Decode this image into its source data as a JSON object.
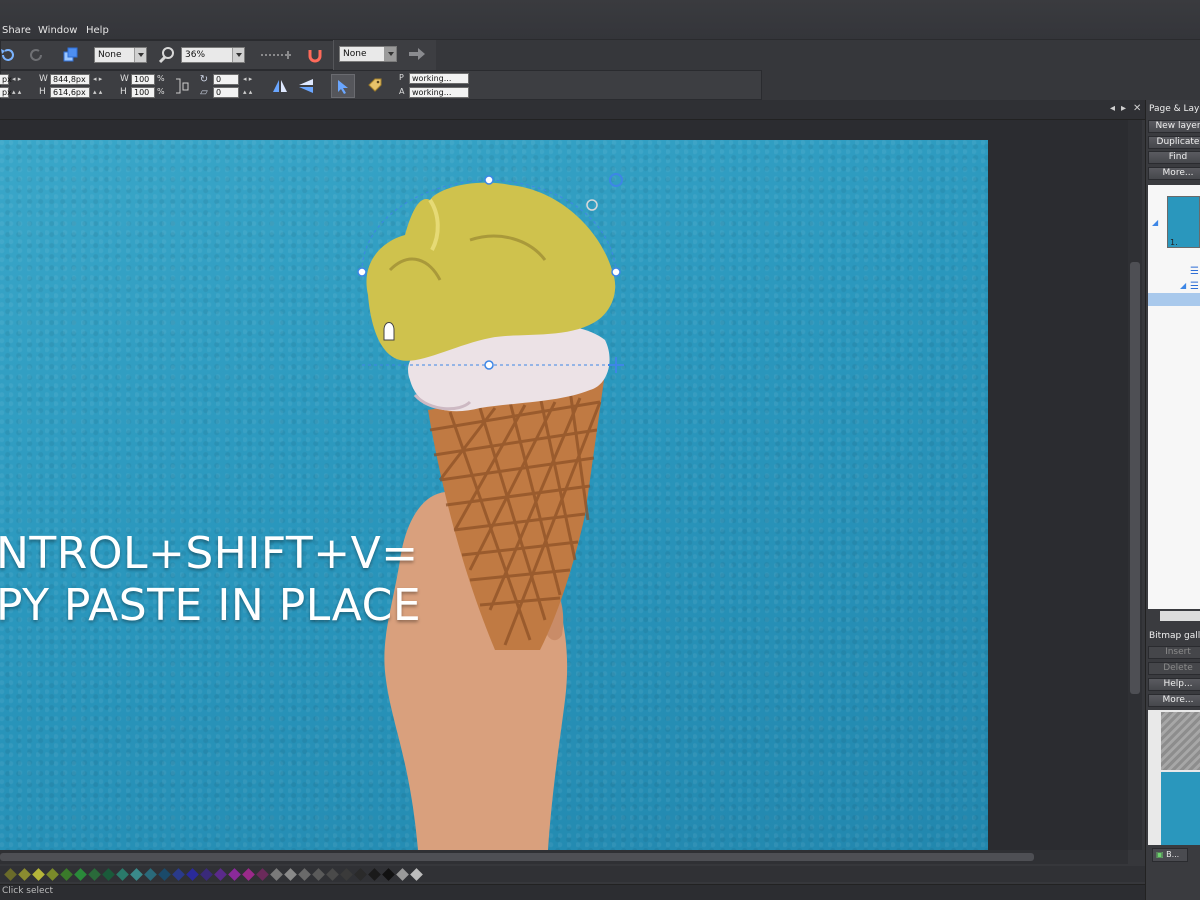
{
  "menu": {
    "items": [
      {
        "label": "Share"
      },
      {
        "label": "Window"
      },
      {
        "label": "Help"
      }
    ]
  },
  "toolbar": {
    "combo_none_1": "None",
    "zoom": "36%",
    "combo_none_2": "None"
  },
  "infobar": {
    "x_unit": "px",
    "y_unit": "px",
    "w_label": "W",
    "w_value": "844,8px",
    "h_label": "H",
    "h_value": "614,6px",
    "w_pct_label": "W",
    "w_pct": "100",
    "h_pct_label": "H",
    "h_pct": "100",
    "pct_sign": "%",
    "rotate_value": "0",
    "skew_value": "0",
    "p_label": "P",
    "p_value": "working...",
    "a_label": "A",
    "a_value": "working..."
  },
  "canvas": {
    "overlay_line1": "NTROL+SHIFT+V=",
    "overlay_line2": "PY PASTE IN PLACE"
  },
  "dock": {
    "title": "Page & Layers",
    "buttons": [
      "New layer",
      "Duplicate",
      "Find",
      "More..."
    ],
    "layer_name": "1.",
    "gallery_title": "Bitmap gallery",
    "gallery_buttons": [
      "Insert",
      "Delete",
      "Help...",
      "More..."
    ],
    "gallery_tab": "B..."
  },
  "status": {
    "text": "Click select"
  },
  "colors": {
    "accent": "#3aa7c9",
    "selection_handle": "#3d86e6"
  }
}
